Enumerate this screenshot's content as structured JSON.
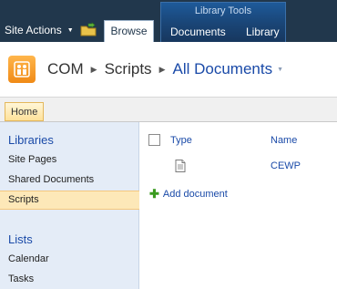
{
  "ribbon": {
    "site_actions_label": "Site Actions",
    "browse_tab": "Browse",
    "tool_group_title": "Library Tools",
    "documents_tab": "Documents",
    "library_tab": "Library"
  },
  "breadcrumb": {
    "site": "COM",
    "section": "Scripts",
    "current": "All Documents"
  },
  "topnav": {
    "home": "Home"
  },
  "leftnav": {
    "libraries_heading": "Libraries",
    "libraries": [
      {
        "label": "Site Pages"
      },
      {
        "label": "Shared Documents"
      },
      {
        "label": "Scripts",
        "selected": true
      }
    ],
    "lists_heading": "Lists",
    "lists": [
      {
        "label": "Calendar"
      },
      {
        "label": "Tasks"
      }
    ]
  },
  "list": {
    "columns": {
      "type": "Type",
      "name": "Name"
    },
    "rows": [
      {
        "type_icon": "text-document-icon",
        "name": "CEWP"
      }
    ],
    "add_document": "Add document"
  },
  "colors": {
    "ribbon_bg": "#21374c",
    "tool_group_bg": "#1a4678",
    "link_blue": "#1a4aa8",
    "selected_bg": "#fde8b8",
    "leftnav_bg": "#e4ecf7"
  }
}
